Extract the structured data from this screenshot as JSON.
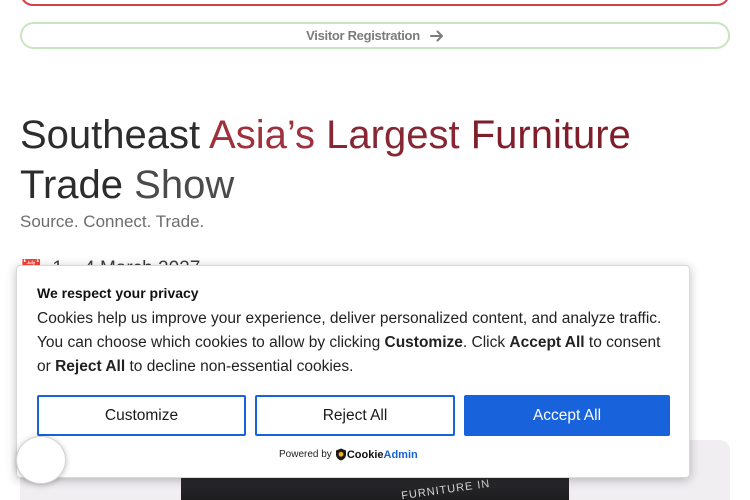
{
  "top_button": {
    "label": ""
  },
  "visitor_button": {
    "label": "Visitor Registration"
  },
  "hero": {
    "title_parts": [
      "Southeast",
      "Asia’s",
      "Largest",
      "Furniture",
      "Trade",
      "Show"
    ],
    "tagline": "Source. Connect. Trade.",
    "date": "1 – 4 March 2027"
  },
  "cookie_banner": {
    "title": "We respect your privacy",
    "text_1": "Cookies help us improve your experience, deliver personalized content, and analyze traffic. You can choose which cookies to allow by clicking ",
    "customize_word": "Customize",
    "text_2": ". Click ",
    "accept_word": "Accept All",
    "text_3": " to consent or ",
    "reject_word": "Reject All",
    "text_4": " to decline non-essential cookies.",
    "customize_label": "Customize",
    "reject_label": "Reject All",
    "accept_label": "Accept All",
    "powered_by": "Powered by",
    "brand_part1": "Cookie",
    "brand_part2": "Admin"
  },
  "hero_image": {
    "sign_text": "FURNITURE IN"
  },
  "colors": {
    "accent_blue": "#1863dc",
    "brand_red": "#a0303b",
    "visitor_border": "#c9e4c1"
  },
  "icons": {
    "visitor_arrow": "arrow-right-icon",
    "date": "calendar-icon",
    "brand_logo": "cookieadmin-shield-icon",
    "revisit": "cookie-revisit-icon"
  }
}
